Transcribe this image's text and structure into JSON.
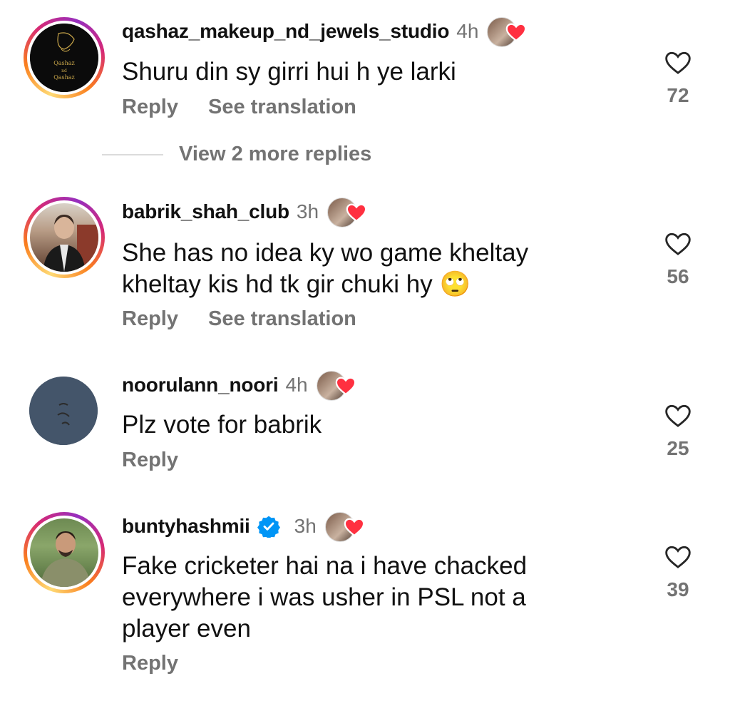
{
  "comments": [
    {
      "username": "qashaz_makeup_nd_jewels_studio",
      "time": "4h",
      "verified": false,
      "text": "Shuru din sy girri hui h ye larki",
      "reply_label": "Reply",
      "translate_label": "See translation",
      "likes": "72",
      "avatar_text": "Qashaz nd Qashaz"
    },
    {
      "username": "babrik_shah_club",
      "time": "3h",
      "verified": false,
      "text": "She has no idea ky wo game kheltay kheltay kis hd tk gir chuki hy 🙄",
      "reply_label": "Reply",
      "translate_label": "See translation",
      "likes": "56"
    },
    {
      "username": "noorulann_noori",
      "time": "4h",
      "verified": false,
      "text": "Plz vote for babrik",
      "reply_label": "Reply",
      "likes": "25"
    },
    {
      "username": "buntyhashmii",
      "time": "3h",
      "verified": true,
      "text": "Fake cricketer hai na i have chacked everywhere i was usher in PSL not a player even",
      "reply_label": "Reply",
      "likes": "39"
    }
  ],
  "view_more": "View 2 more replies",
  "icons": {
    "like": "heart-outline-icon",
    "liked_by": "creator-liked-heart-icon",
    "verified": "verified-badge-icon"
  },
  "colors": {
    "heart_red": "#ff3040",
    "verified_blue": "#0095f6",
    "muted": "#737373"
  }
}
